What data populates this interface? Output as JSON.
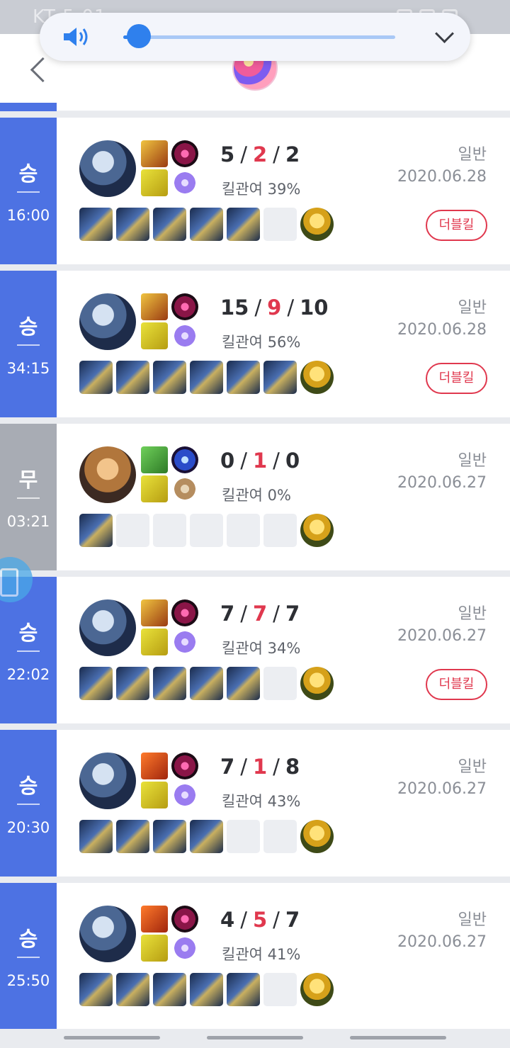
{
  "status_bar": {
    "carrier_time": "KT 5:01"
  },
  "volume": {
    "level_fraction": 0.04
  },
  "matches": [
    {
      "result": "승",
      "duration": "16:00",
      "kda": {
        "kills": "5",
        "deaths": "2",
        "assists": "2"
      },
      "kill_participation": "킬관여 39%",
      "queue": "일반",
      "date": "2020.06.28",
      "badge": "더블킬",
      "items": [
        true,
        true,
        true,
        true,
        true,
        false
      ],
      "champion": "wolf"
    },
    {
      "result": "승",
      "duration": "34:15",
      "kda": {
        "kills": "15",
        "deaths": "9",
        "assists": "10"
      },
      "kill_participation": "킬관여 56%",
      "queue": "일반",
      "date": "2020.06.28",
      "badge": "더블킬",
      "items": [
        true,
        true,
        true,
        true,
        true,
        true
      ],
      "champion": "wolf"
    },
    {
      "result": "무",
      "duration": "03:21",
      "kda": {
        "kills": "0",
        "deaths": "1",
        "assists": "0"
      },
      "kill_participation": "킬관여 0%",
      "queue": "일반",
      "date": "2020.06.27",
      "badge": "",
      "items": [
        true,
        false,
        false,
        false,
        false,
        false
      ],
      "champion": "ezreal"
    },
    {
      "result": "승",
      "duration": "22:02",
      "kda": {
        "kills": "7",
        "deaths": "7",
        "assists": "7"
      },
      "kill_participation": "킬관여 34%",
      "queue": "일반",
      "date": "2020.06.27",
      "badge": "더블킬",
      "items": [
        true,
        true,
        true,
        true,
        true,
        false
      ],
      "champion": "wolf"
    },
    {
      "result": "승",
      "duration": "20:30",
      "kda": {
        "kills": "7",
        "deaths": "1",
        "assists": "8"
      },
      "kill_participation": "킬관여 43%",
      "queue": "일반",
      "date": "2020.06.27",
      "badge": "",
      "items": [
        true,
        true,
        true,
        true,
        false,
        false
      ],
      "champion": "wolf"
    },
    {
      "result": "승",
      "duration": "25:50",
      "kda": {
        "kills": "4",
        "deaths": "5",
        "assists": "7"
      },
      "kill_participation": "킬관여 41%",
      "queue": "일반",
      "date": "2020.06.27",
      "badge": "",
      "items": [
        true,
        true,
        true,
        true,
        true,
        false
      ],
      "champion": "wolf"
    }
  ],
  "colors": {
    "win": "#4d72e3",
    "draw": "#a8acb4",
    "death": "#e0384e",
    "badge": "#e0384e"
  }
}
